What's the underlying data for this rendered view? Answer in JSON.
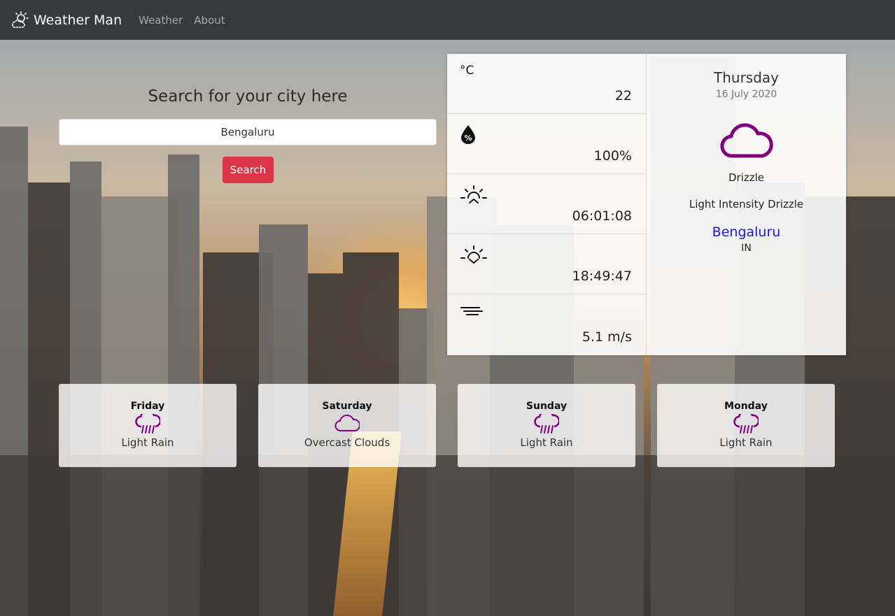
{
  "navbar": {
    "brand": "Weather Man",
    "links": [
      "Weather",
      "About"
    ]
  },
  "search": {
    "title": "Search for your city here",
    "value": "Bengaluru",
    "button": "Search"
  },
  "stats": {
    "temperature_unit": "°C",
    "temperature": "22",
    "humidity": "100%",
    "sunrise": "06:01:08",
    "sunset": "18:49:47",
    "wind": "5.1 m/s"
  },
  "today": {
    "day": "Thursday",
    "date": "16 July 2020",
    "main": "Drizzle",
    "description": "Light Intensity Drizzle",
    "city": "Bengaluru",
    "country": "IN"
  },
  "forecast": [
    {
      "day": "Friday",
      "desc": "Light Rain",
      "icon": "rain-icon"
    },
    {
      "day": "Saturday",
      "desc": "Overcast Clouds",
      "icon": "cloud-icon"
    },
    {
      "day": "Sunday",
      "desc": "Light Rain",
      "icon": "rain-icon"
    },
    {
      "day": "Monday",
      "desc": "Light Rain",
      "icon": "rain-icon"
    }
  ],
  "colors": {
    "navbar": "#343a40",
    "search_button": "#dc3545",
    "weather_icon": "#800080",
    "city_link": "#1a1ad6"
  }
}
